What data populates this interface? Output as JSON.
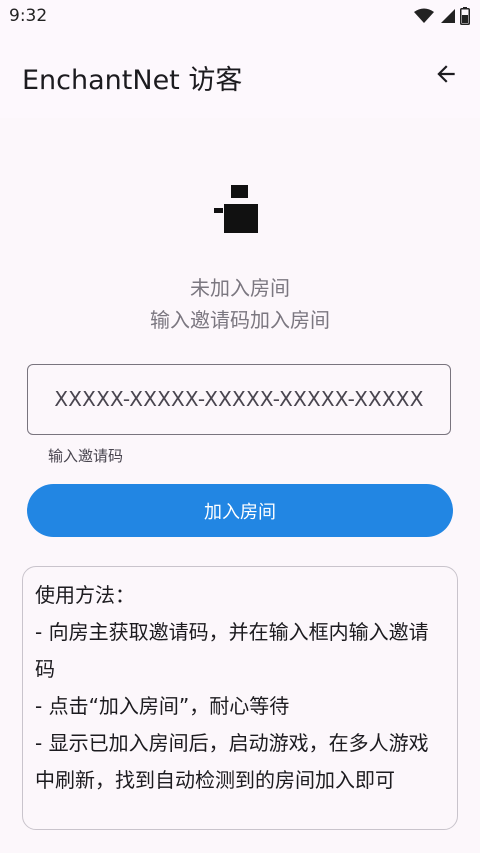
{
  "status_bar": {
    "time": "9:32",
    "icons": [
      "wifi-icon",
      "signal-icon",
      "battery-icon"
    ]
  },
  "app_bar": {
    "title": "EnchantNet 访客",
    "back_icon": "arrow-back-icon"
  },
  "room": {
    "status_line1": "未加入房间",
    "status_line2": "输入邀请码加入房间"
  },
  "invite": {
    "placeholder": "XXXXX-XXXXX-XXXXX-XXXXX-XXXXX",
    "helper": "输入邀请码"
  },
  "join_button_label": "加入房间",
  "usage": {
    "title": "使用方法：",
    "lines": [
      " - 向房主获取邀请码，并在输入框内输入邀请码",
      " - 点击“加入房间”，耐心等待",
      " - 显示已加入房间后，启动游戏，在多人游戏中刷新，找到自动检测到的房间加入即可"
    ]
  },
  "colors": {
    "accent": "#2286e3",
    "background": "#fcf7fb",
    "muted_text": "#7b7780"
  }
}
